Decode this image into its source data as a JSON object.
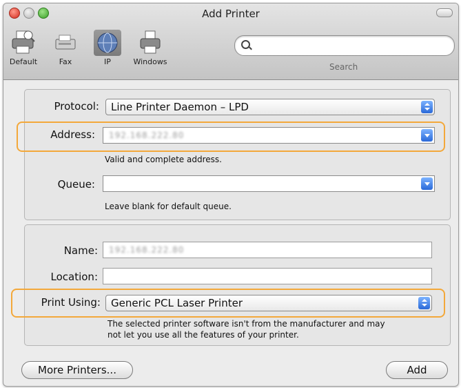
{
  "window": {
    "title": "Add Printer"
  },
  "toolbar": {
    "items": [
      {
        "label": "Default",
        "icon": "default-printer-icon"
      },
      {
        "label": "Fax",
        "icon": "fax-icon"
      },
      {
        "label": "IP",
        "icon": "ip-globe-icon",
        "selected": true
      },
      {
        "label": "Windows",
        "icon": "windows-printer-icon"
      }
    ],
    "search_label": "Search",
    "search_value": ""
  },
  "connection": {
    "protocol_label": "Protocol:",
    "protocol_value": "Line Printer Daemon – LPD",
    "address_label": "Address:",
    "address_value": "192.168.222.80",
    "address_hint": "Valid and complete address.",
    "queue_label": "Queue:",
    "queue_value": "",
    "queue_hint": "Leave blank for default queue."
  },
  "details": {
    "name_label": "Name:",
    "name_value": "192.168.222.80",
    "location_label": "Location:",
    "location_value": "",
    "print_using_label": "Print Using:",
    "print_using_value": "Generic PCL Laser Printer",
    "warning_line1": "The selected printer software isn't from the manufacturer and may",
    "warning_line2": "not let you use all the features of your printer."
  },
  "buttons": {
    "more_printers": "More Printers...",
    "add": "Add"
  },
  "colors": {
    "highlight": "#f3a83a",
    "popup_arrow": "#2a69d8"
  }
}
